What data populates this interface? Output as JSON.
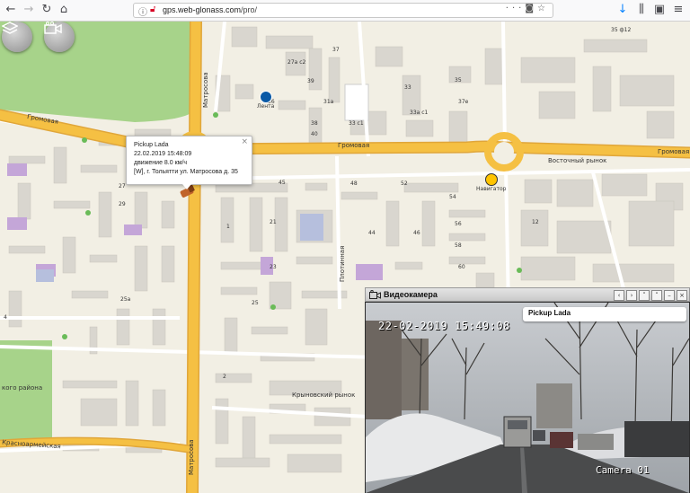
{
  "browser": {
    "url_host": "gps.web-glonass.com",
    "url_path": "/pro/"
  },
  "map": {
    "labels": {
      "matrosova_top": "Матросова",
      "matrosova_bottom": "Матросова",
      "gromovaya_left": "Громовая",
      "gromovaya_mid": "Громовая",
      "gromovaya_right": "Громовая",
      "plotinnaya": "Плотинная",
      "vostochny": "Восточный рынок",
      "krynovsky": "Крыновский рынок",
      "krasnoarmeyskaya": "Красноармейская",
      "park": "кого района",
      "lenta": "Лента",
      "navigator": "Навигатор"
    },
    "house_numbers": [
      "27а с2",
      "37",
      "39",
      "36",
      "31а",
      "38",
      "40",
      "33",
      "33а с1",
      "33 с1",
      "35",
      "37е",
      "48",
      "52",
      "54",
      "56",
      "58",
      "60",
      "21",
      "23",
      "25",
      "1",
      "12",
      "25а",
      "35 ф12",
      "27",
      "29",
      "44",
      "46",
      "45",
      "2",
      "4"
    ]
  },
  "popup": {
    "vehicle": "Pickup Lada",
    "datetime": "22.02.2019 15:48:09",
    "speed": "движение 8.0 км/ч",
    "address": "[W], г. Тольятти ул. Матросова д. 35",
    "close": "×"
  },
  "video": {
    "window_title": "Видеокамера",
    "vehicle_label": "Pickup Lada",
    "timestamp": "22-02-2019 15:49:08",
    "camera": "Camera 01"
  },
  "colors": {
    "road_main": "#f5c043",
    "road_edge": "#e0a63a",
    "map_bg": "#f2efe4",
    "park": "#a7d38a",
    "building": "#d9d6cf"
  }
}
